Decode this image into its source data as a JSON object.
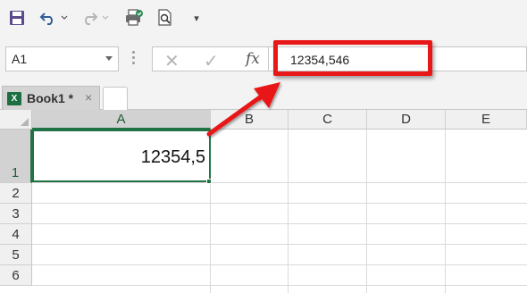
{
  "toolbar": {
    "icons": [
      "save-icon",
      "undo-icon",
      "redo-icon",
      "print-icon",
      "print-preview-icon",
      "customize-icon"
    ],
    "customize_glyph": "▾"
  },
  "formula_bar": {
    "name_box_value": "A1",
    "cancel_glyph": "✕",
    "enter_glyph": "✓",
    "fx_label": "fx",
    "formula_value": "12354,546"
  },
  "workbook_tab": {
    "label": "Book1 *",
    "close_glyph": "×",
    "excel_glyph": "X"
  },
  "grid": {
    "columns": [
      "A",
      "B",
      "C",
      "D",
      "E"
    ],
    "rows": [
      "1",
      "2",
      "3",
      "4",
      "5",
      "6"
    ],
    "active_cell": "A1",
    "cell_a1_display": "12354,5"
  },
  "colors": {
    "accent_green": "#217346",
    "highlight_red": "#e81818",
    "save_icon": "#5b4a8c"
  }
}
